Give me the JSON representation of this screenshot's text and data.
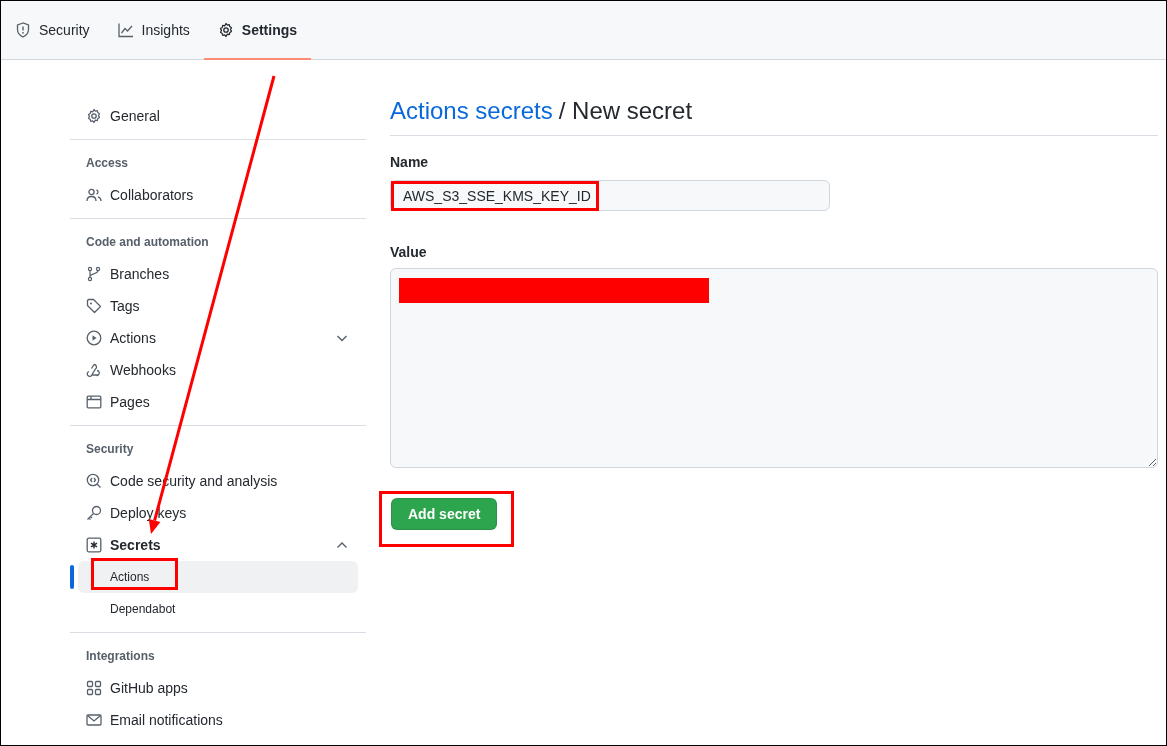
{
  "tabs": [
    {
      "label": "Security",
      "selected": false
    },
    {
      "label": "Insights",
      "selected": false
    },
    {
      "label": "Settings",
      "selected": true
    }
  ],
  "sidebar": {
    "sections": [
      {
        "items": [
          {
            "label": "General",
            "selected": false
          }
        ]
      },
      {
        "heading": "Access",
        "items": [
          {
            "label": "Collaborators",
            "selected": false
          }
        ]
      },
      {
        "heading": "Code and automation",
        "items": [
          {
            "label": "Branches",
            "selected": false
          },
          {
            "label": "Tags",
            "selected": false
          },
          {
            "label": "Actions",
            "selected": false,
            "expanded": false
          },
          {
            "label": "Webhooks",
            "selected": false
          },
          {
            "label": "Pages",
            "selected": false
          }
        ]
      },
      {
        "heading": "Security",
        "items": [
          {
            "label": "Code security and analysis",
            "selected": false
          },
          {
            "label": "Deploy keys",
            "selected": false
          },
          {
            "label": "Secrets",
            "selected": false,
            "expanded": true,
            "children": [
              {
                "label": "Actions",
                "selected": true
              },
              {
                "label": "Dependabot",
                "selected": false
              }
            ]
          }
        ]
      },
      {
        "heading": "Integrations",
        "items": [
          {
            "label": "GitHub apps",
            "selected": false
          },
          {
            "label": "Email notifications",
            "selected": false
          }
        ]
      }
    ]
  },
  "main": {
    "breadcrumb_link": "Actions secrets",
    "title": "/ New secret",
    "name_field": {
      "label": "Name",
      "value": "AWS_S3_SSE_KMS_KEY_ID"
    },
    "value_field": {
      "label": "Value",
      "redacted": true
    },
    "submit_button": "Add secret"
  }
}
